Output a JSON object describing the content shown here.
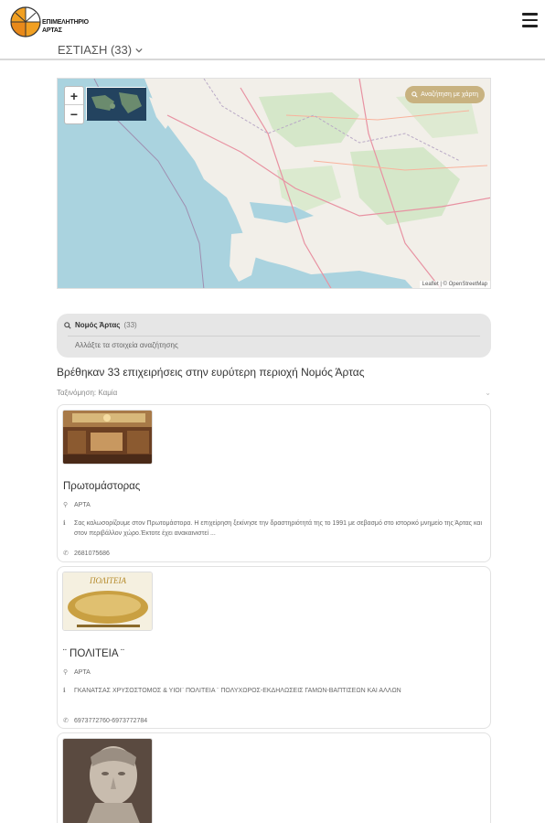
{
  "header": {
    "logo_text_line1": "ΕΠΙΜΕΛΗΤΗΡΙΟ",
    "logo_text_line2": "ΑΡΤΑΣ",
    "category": "ΕΣΤΙΑΣΗ (33)",
    "menu_icon": "hamburger-menu-icon"
  },
  "map": {
    "zoom_in": "+",
    "zoom_out": "−",
    "search_button": "Αναζήτηση με χάρτη",
    "attribution": "Leaflet | © OpenStreetMap"
  },
  "search": {
    "location": "Νομός Άρτας",
    "count": "(33)",
    "change_label": "Αλλάξτε τα στοιχεία αναζήτησης"
  },
  "results_text": "Βρέθηκαν 33 επιχειρήσεις στην ευρύτερη περιοχή Νομός Άρτας",
  "sort_text": "Ταξινόμηση: Καμία",
  "cards": [
    {
      "title": "Πρωτομάστορας",
      "location": "ΑΡΤΑ",
      "description": "Σας καλωσορίζουμε στον Πρωτομάστορα.   Η επιχείρηση ξεκίνησε την δραστηριότητά της το 1991 με σεβασμό στο ιστορικό μνημείο της Άρτας και στον περιβάλλον χώρο.Έκτοτε έχει ανακαινιστεί ...",
      "phone": "2681075686"
    },
    {
      "title": "¨ ΠΟΛΙΤΕΙΑ ¨",
      "location": "ΑΡΤΑ",
      "description": "ΓΚΑΝΑΤΣΑΣ ΧΡΥΣΟΣΤΟΜΟΣ & ΥΙΟΙ¨ ΠΟΛΙΤΕΙΑ ¨ ΠΟΛΥΧΩΡΟΣ-ΕΚΔΗΛΩΣΕΙΣ ΓΑΜΩΝ-ΒΑΠΤΙΣΕΩΝ ΚΑΙ ΑΛΛΩΝ",
      "phone": "6973772760-6973772784"
    }
  ],
  "colors": {
    "accent": "#c8b280",
    "water": "#aad3df",
    "land": "#f2efe9",
    "searchbox": "#e6e6e6"
  }
}
